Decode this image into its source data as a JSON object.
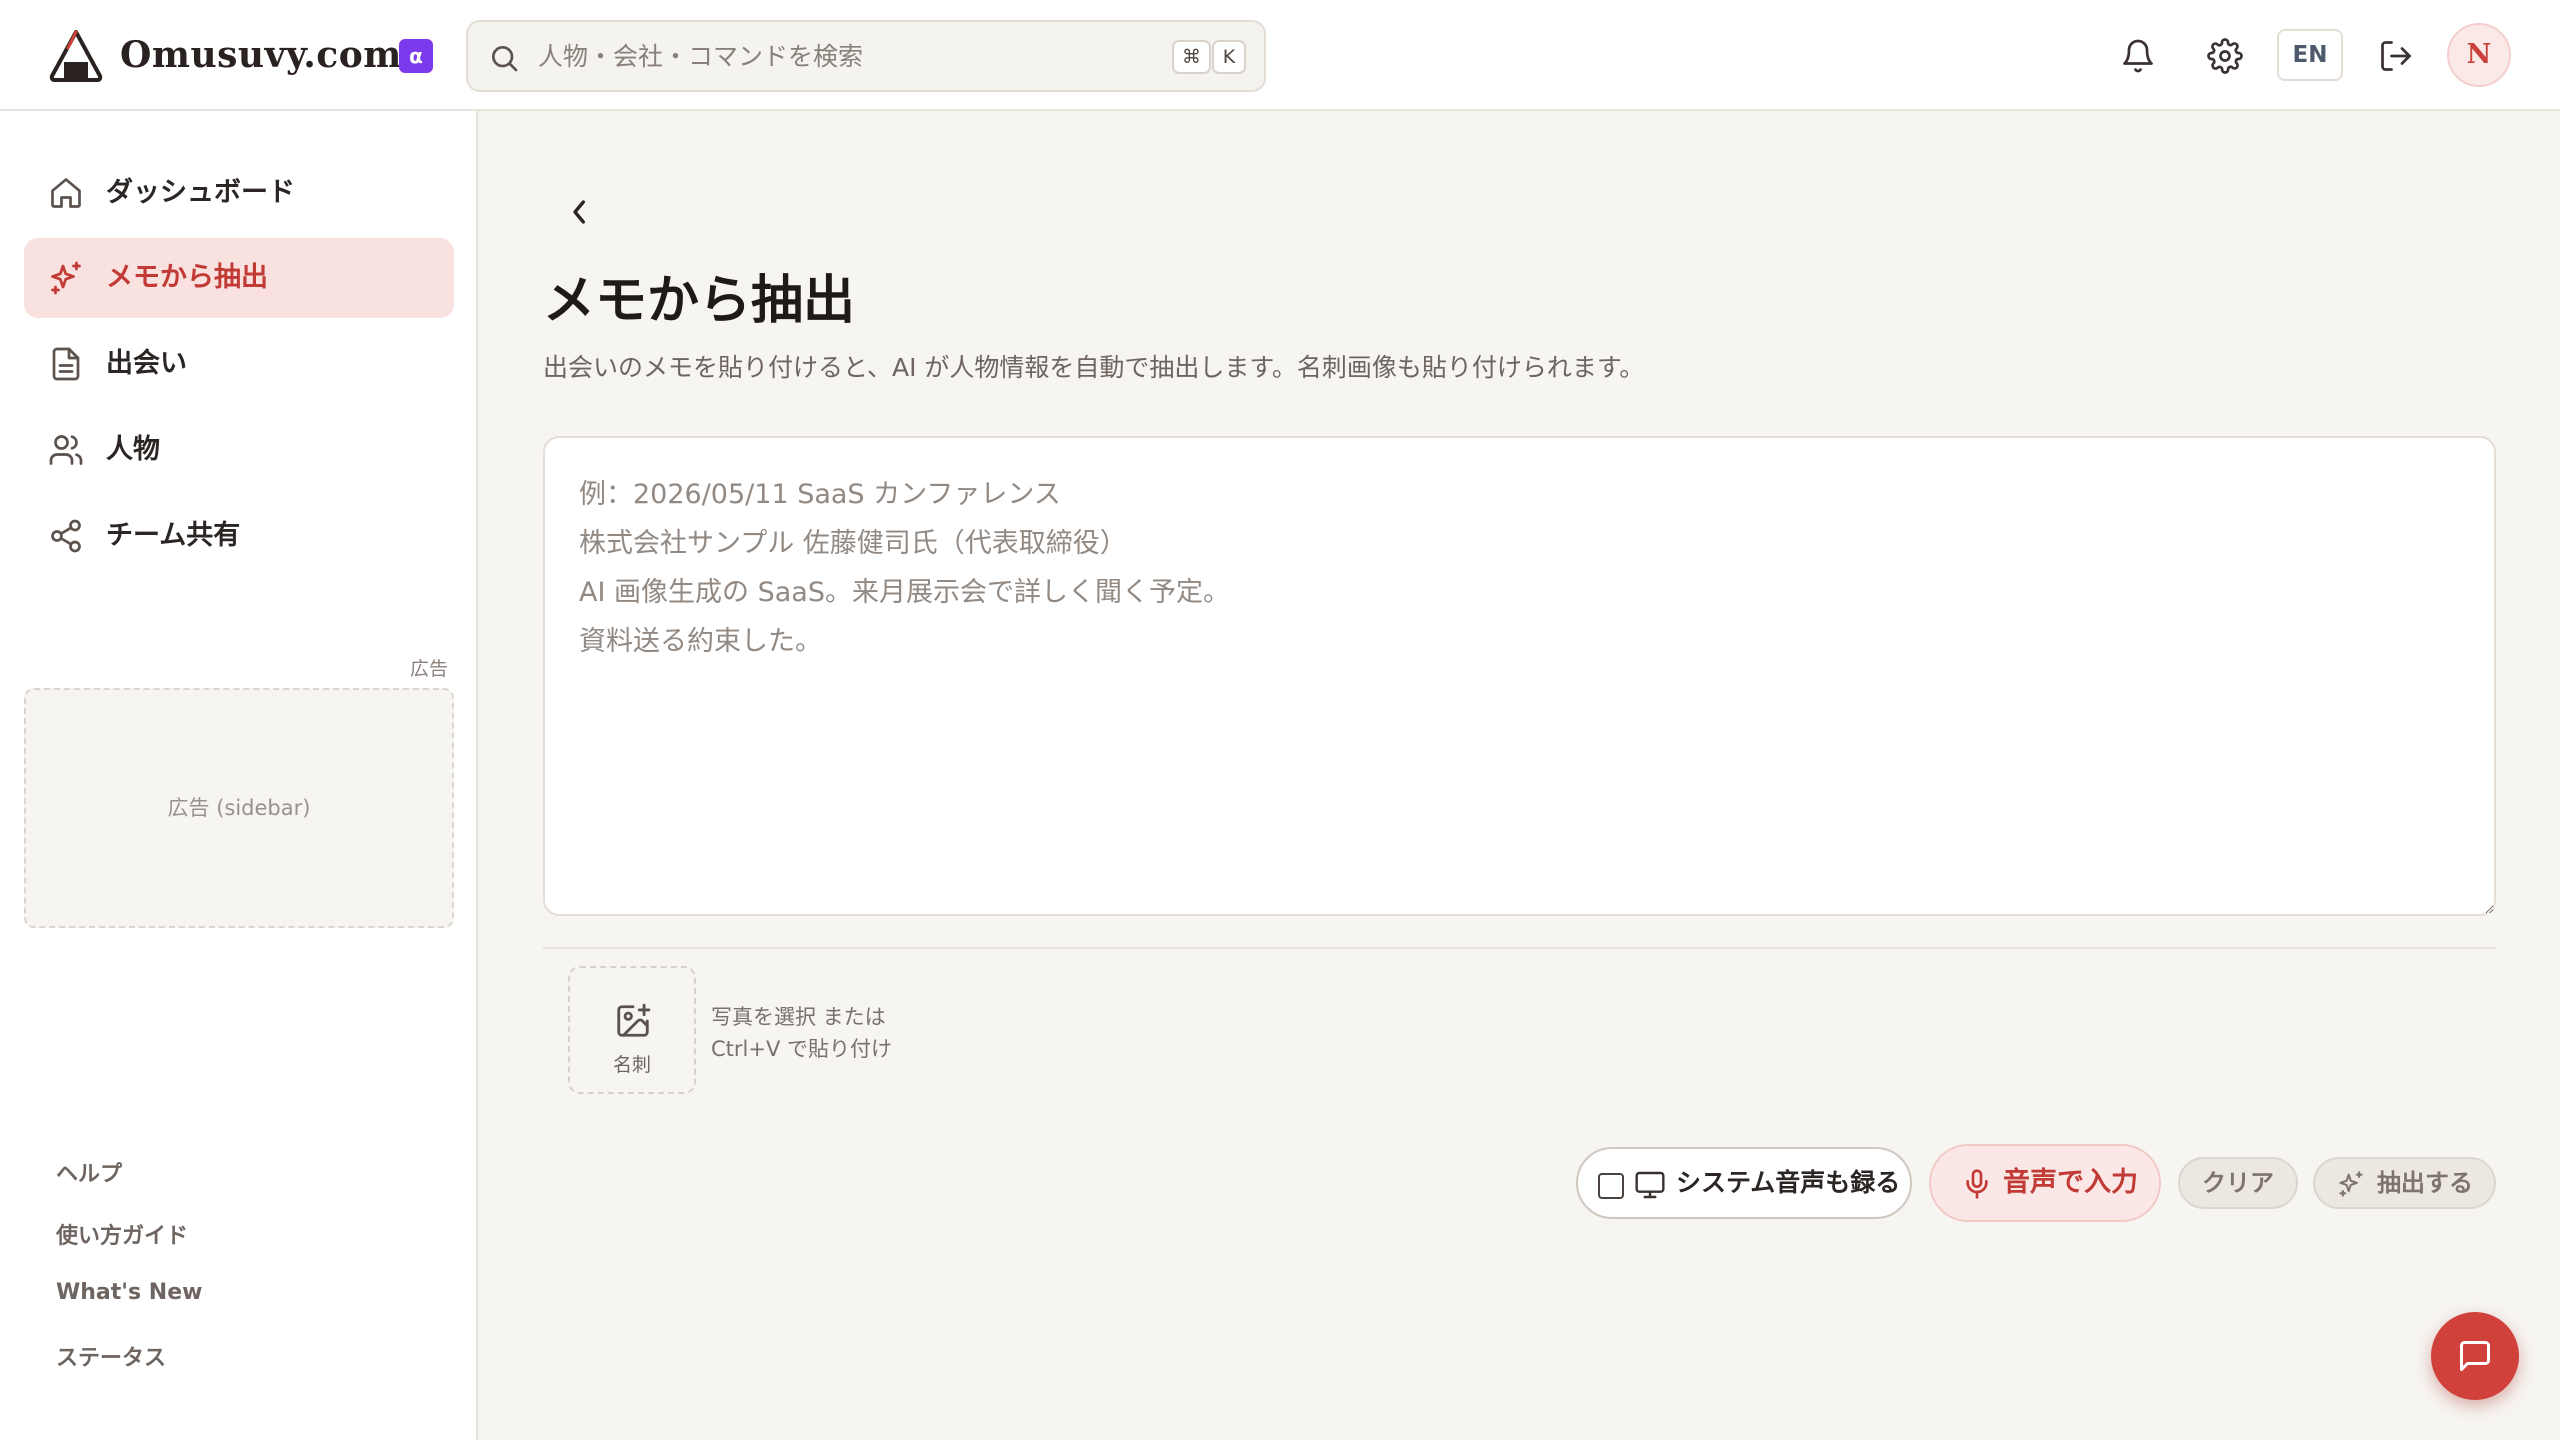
{
  "header": {
    "brand": "Omusuvy.com",
    "badge": "α",
    "search": {
      "placeholder": "人物・会社・コマンドを検索",
      "shortcut_mod": "⌘",
      "shortcut_key": "K"
    },
    "lang_button": "EN",
    "avatar_initial": "N",
    "icons": [
      "onigiri-logo-icon",
      "search-icon",
      "bell-icon",
      "gear-icon",
      "logout-icon"
    ]
  },
  "sidebar": {
    "items": [
      {
        "label": "ダッシュボード",
        "icon": "home-icon",
        "active": false
      },
      {
        "label": "メモから抽出",
        "icon": "sparkles-icon",
        "active": true
      },
      {
        "label": "出会い",
        "icon": "document-icon",
        "active": false
      },
      {
        "label": "人物",
        "icon": "users-icon",
        "active": false
      },
      {
        "label": "チーム共有",
        "icon": "share-icon",
        "active": false
      }
    ],
    "ad_tag": "広告",
    "ad_placeholder": "広告 (sidebar)",
    "footer_links": [
      "ヘルプ",
      "使い方ガイド",
      "What's New",
      "ステータス"
    ]
  },
  "main": {
    "title": "メモから抽出",
    "description": "出会いのメモを貼り付けると、AI が人物情報を自動で抽出します。名刺画像も貼り付けられます。",
    "memo": {
      "value": "",
      "placeholder": "例：2026/05/11 SaaS カンファレンス\n株式会社サンプル 佐藤健司氏（代表取締役）\nAI 画像生成の SaaS。来月展示会で詳しく聞く予定。\n資料送る約束した。"
    },
    "card_upload": {
      "label": "名刺",
      "hint_line1": "写真を選択 または",
      "hint_line2": "Ctrl+V で貼り付け"
    },
    "actions": {
      "system_audio": {
        "label": "システム音声も録る",
        "checked": false
      },
      "voice_input": "音声で入力",
      "clear": "クリア",
      "extract": "抽出する"
    }
  },
  "colors": {
    "accent": "#c13a35",
    "accent_bg": "#f8e1df",
    "badge": "#7c3aed",
    "fab": "#d0413b",
    "page_bg": "#f7f5f1"
  }
}
